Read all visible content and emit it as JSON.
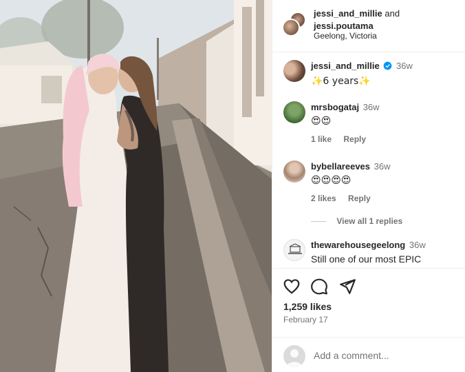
{
  "post": {
    "header": {
      "author": "jessi_and_millie",
      "joiner": "and",
      "coauthor": "jessi.poutama",
      "location": "Geelong, Victoria"
    },
    "comments": [
      {
        "user": "jessi_and_millie",
        "verified": true,
        "time": "36w",
        "text": "✨6 years✨"
      },
      {
        "user": "mrsbogataj",
        "time": "36w",
        "text": "😍😍",
        "likes": "1 like",
        "reply": "Reply"
      },
      {
        "user": "bybellareeves",
        "time": "36w",
        "text": "😍😍😍😍",
        "likes": "2 likes",
        "reply": "Reply"
      },
      {
        "user": "thewarehousegeelong",
        "time": "36w",
        "text": "Still one of our most EPIC"
      }
    ],
    "view_replies": "View all 1 replies",
    "actions": {
      "like_icon": "heart-icon",
      "comment_icon": "speech-bubble-icon",
      "share_icon": "paper-plane-icon"
    },
    "likes": "1,259 likes",
    "date": "February 17",
    "add_comment_placeholder": "Add a comment...",
    "colors": {
      "verified": "#0095f6",
      "meta": "#737373",
      "text": "#262626",
      "divider": "#efefef"
    }
  }
}
